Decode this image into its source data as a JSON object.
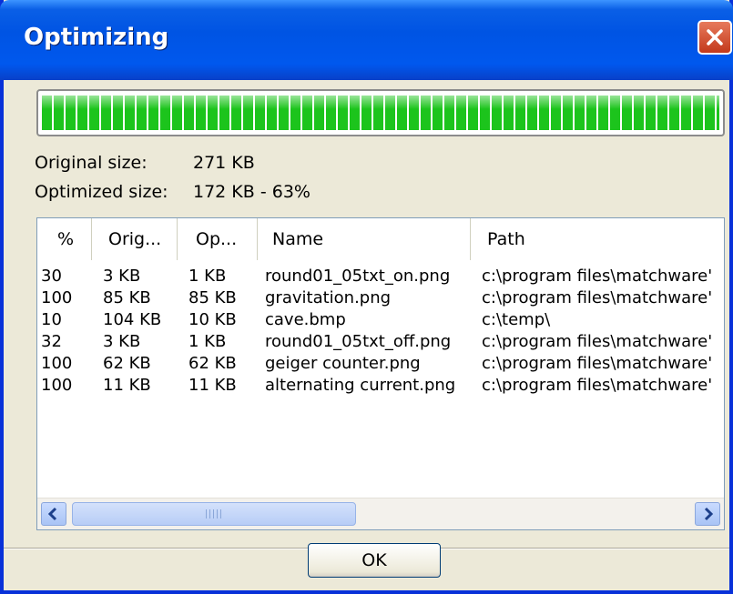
{
  "window": {
    "title": "Optimizing"
  },
  "progress": {
    "fraction": 1.0
  },
  "summary": {
    "original_label": "Original size:",
    "original_value": "271 KB",
    "optimized_label": "Optimized size:",
    "optimized_value": "172 KB - 63%"
  },
  "table": {
    "columns": [
      "%",
      "Orig...",
      "Op...",
      "Name",
      "Path"
    ],
    "rows": [
      [
        "30",
        "3 KB",
        "1 KB",
        "round01_05txt_on.png",
        "c:\\program files\\matchware'"
      ],
      [
        "100",
        "85 KB",
        "85 KB",
        "gravitation.png",
        "c:\\program files\\matchware'"
      ],
      [
        "10",
        "104 KB",
        "10 KB",
        "cave.bmp",
        "c:\\temp\\"
      ],
      [
        "32",
        "3 KB",
        "1 KB",
        "round01_05txt_off.png",
        "c:\\program files\\matchware'"
      ],
      [
        "100",
        "62 KB",
        "62 KB",
        "geiger counter.png",
        "c:\\program files\\matchware'"
      ],
      [
        "100",
        "11 KB",
        "11 KB",
        "alternating current.png",
        "c:\\program files\\matchware'"
      ]
    ]
  },
  "buttons": {
    "ok": "OK"
  },
  "colors": {
    "titlebar": "#0054e3",
    "progress": "#1cc41c",
    "close": "#c3391b"
  },
  "icons": {
    "close": "close-icon",
    "scroll_left": "chevron-left-icon",
    "scroll_right": "chevron-right-icon"
  }
}
